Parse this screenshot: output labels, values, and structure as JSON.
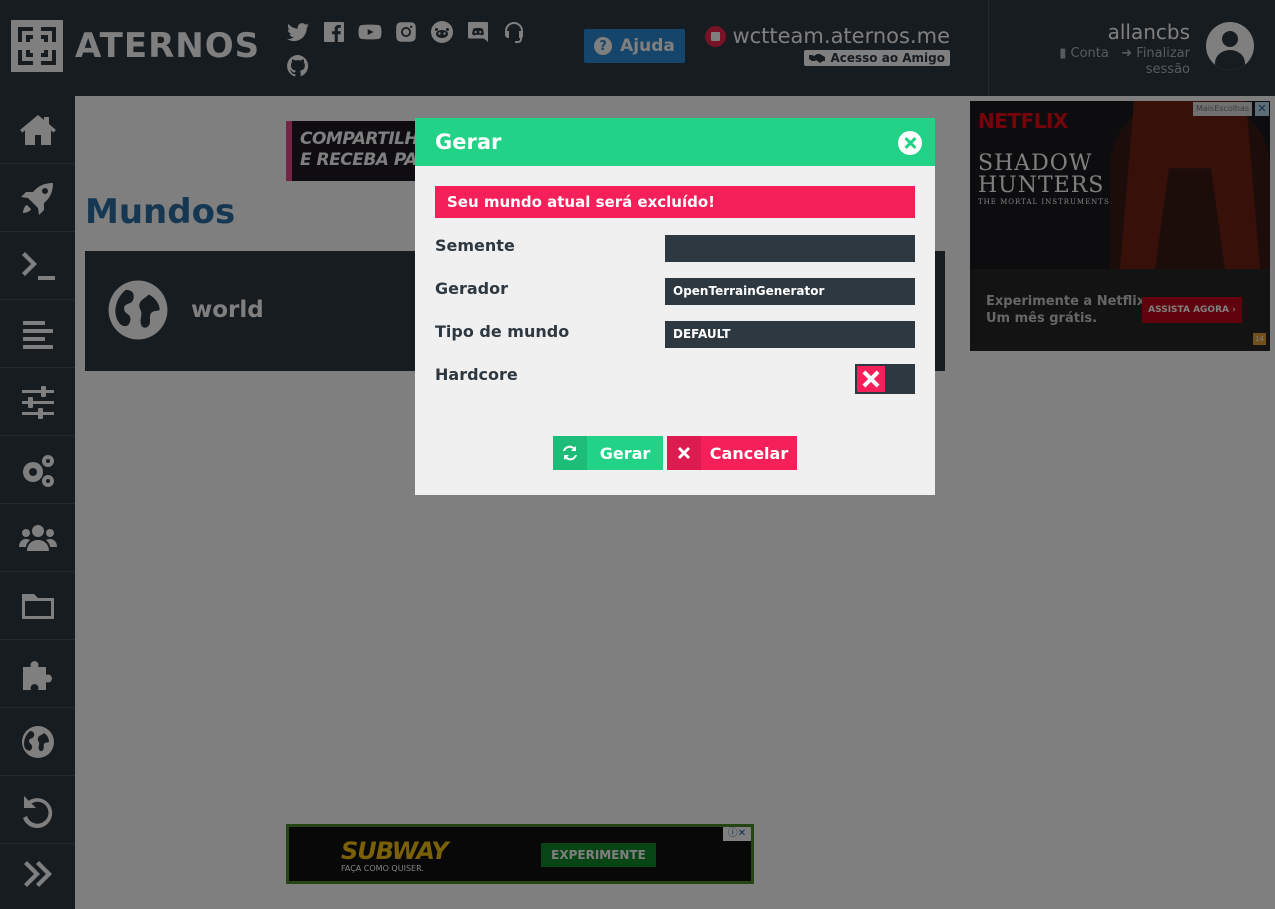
{
  "header": {
    "logo_text": "ATERNOS",
    "help_label": "Ajuda",
    "server_address": "wctteam.aternos.me",
    "friend_access_label": "Acesso ao Amigo",
    "username": "allancbs",
    "account_label": "Conta",
    "logout_label": "Finalizar sessão"
  },
  "social_icons": [
    "twitter-icon",
    "facebook-icon",
    "youtube-icon",
    "instagram-icon",
    "reddit-icon",
    "discord-icon",
    "support-icon",
    "github-icon"
  ],
  "sidebar_items": [
    "home",
    "server",
    "console",
    "log",
    "options",
    "software",
    "players",
    "files",
    "plugins",
    "worlds",
    "backups",
    "expand"
  ],
  "content": {
    "banner_top_text_1": "COMPARTILHE LIN",
    "banner_top_text_2": "E RECEBA PAGAME",
    "page_title": "Mundos",
    "world_name": "world"
  },
  "ad_right": {
    "brand": "NETFLIX",
    "show_line1": "SHADOW",
    "show_line2": "HUNTERS",
    "show_sub": "THE MORTAL INSTRUMENTS",
    "text_line1": "Experimente a Netflix",
    "text_line2": "Um mês grátis.",
    "cta": "ASSISTA AGORA",
    "tag": "MaisEscolhas",
    "age": "14"
  },
  "ad_bottom": {
    "logo": "SUBWAY",
    "sub": "FAÇA COMO QUISER.",
    "cta": "EXPERIMENTE"
  },
  "modal": {
    "title": "Gerar",
    "warning": "Seu mundo atual será excluído!",
    "seed_label": "Semente",
    "seed_value": "",
    "generator_label": "Gerador",
    "generator_value": "OpenTerrainGenerator",
    "world_type_label": "Tipo de mundo",
    "world_type_value": "DEFAULT",
    "hardcore_label": "Hardcore",
    "hardcore_enabled": false,
    "generate_label": "Gerar",
    "cancel_label": "Cancelar"
  },
  "colors": {
    "header_bg": "#2e3841",
    "accent_green": "#21d287",
    "accent_red": "#f5205a",
    "help_blue": "#2d8ad8",
    "title_blue": "#2c6ea5"
  }
}
